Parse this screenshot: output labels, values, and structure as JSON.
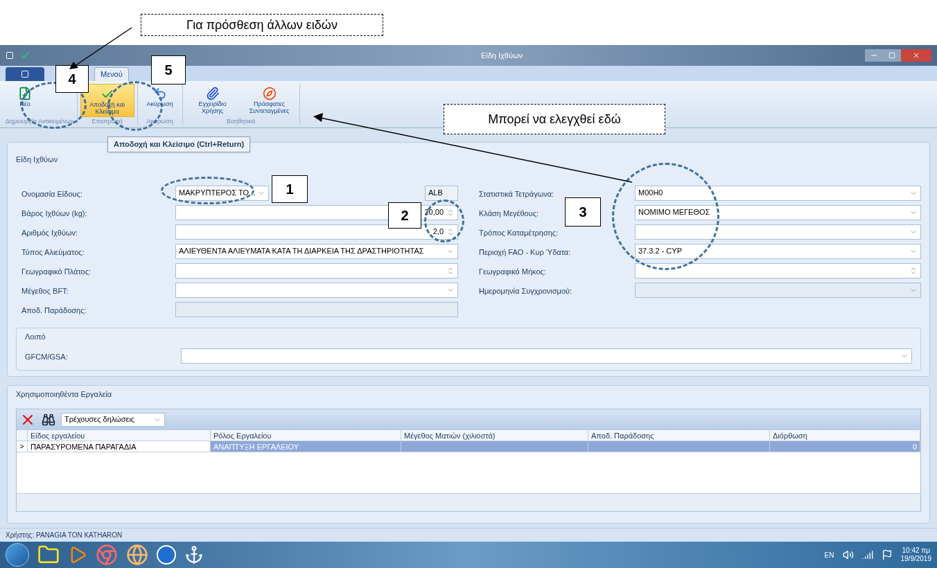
{
  "annotations": {
    "callouts": [
      {
        "text": "Για πρόσθεση άλλων ειδών"
      },
      {
        "text": "Μπορεί να ελεγχθεί εδώ"
      }
    ],
    "markers": [
      {
        "text": "4"
      },
      {
        "text": "5"
      },
      {
        "text": "1"
      },
      {
        "text": "2"
      },
      {
        "text": "3"
      }
    ]
  },
  "window": {
    "title": "Είδη Ιχθύων"
  },
  "tabs": [
    {
      "label": "Μενού",
      "selected": true
    }
  ],
  "ribbon": [
    {
      "group": "Δημιουργία Αντικειμένων",
      "buttons": [
        {
          "label": "Νέο",
          "hovered": false
        }
      ]
    },
    {
      "group": "Επιστροφή",
      "buttons": [
        {
          "label": "Αποδοχή και Κλείσιμο",
          "hovered": true
        }
      ]
    },
    {
      "group": "Ακύρωση",
      "buttons": [
        {
          "label": "Ακύρωση",
          "hovered": false
        }
      ]
    },
    {
      "group": "Βοηθητικά",
      "buttons": [
        {
          "label": "Εγχειρίδιο Χρήσης",
          "hovered": false
        },
        {
          "label": "Πρόσφατες Συντεταγμένες",
          "hovered": false
        }
      ]
    }
  ],
  "tooltip": "Αποδοχή και Κλείσιμο (Ctrl+Return)",
  "species_group": {
    "title": "Είδη Ιχθύων",
    "left_fields": [
      {
        "label": "Ονομασία Είδους:",
        "kind": "combo_short",
        "value": "ΜΑΚΡΥΠΤΕΡΟΣ ΤΟ...",
        "code": "ALB"
      },
      {
        "label": "Βάρος Ιχθύων (kg):",
        "kind": "spin",
        "value": "20,00"
      },
      {
        "label": "Αριθμός Ιχθύων:",
        "kind": "spin",
        "value": "2,0"
      },
      {
        "label": "Τύπος Αλιεύματος:",
        "kind": "combo",
        "value": "ΑΛΙΕΥΘΕΝΤΑ ΑΛΙΕΥΜΑΤΑ ΚΑΤΑ ΤΗ ΔΙΑΡΚΕΙΑ ΤΗΣ ΔΡΑΣΤΗΡΙΟΤΗΤΑΣ"
      },
      {
        "label": "Γεωγραφικό Πλάτος:",
        "kind": "spin"
      },
      {
        "label": "Μέγεθος BFT:",
        "kind": "combo"
      },
      {
        "label": "Αποδ. Παράδοσης:",
        "kind": "readonly"
      }
    ],
    "right_fields": [
      {
        "label": "Στατιστικά Τετράγωνα:",
        "kind": "combo",
        "value": "M00H0"
      },
      {
        "label": "Κλάση Μεγέθους:",
        "kind": "combo",
        "value": "ΝΟΜΙΜΟ ΜΕΓΕΘΟΣ"
      },
      {
        "label": "Τρόπος Καταμέτρησης:",
        "kind": "combo"
      },
      {
        "label": "Περιοχή FAO - Κυρ Ύδατα:",
        "kind": "combo",
        "value": "37.3.2 - CYP"
      },
      {
        "label": "Γεωγραφικό Μήκος:",
        "kind": "spin"
      },
      {
        "label": "Ημερομηνία Συγχρονισμού:",
        "kind": "readonly_combo"
      }
    ]
  },
  "other_group": {
    "title": "Λοιπό",
    "fields": [
      {
        "label": "GFCM/GSA:",
        "kind": "combo"
      }
    ]
  },
  "tools_group": {
    "title": "Χρησιμοποιηθέντα Εργαλεία",
    "filter": "Τρέχουσες δηλώσεις",
    "columns": [
      "Είδος εργαλείου",
      "Ρόλος Εργαλείου",
      "Μέγεθος Ματιών (χιλιοστά)",
      "Αποδ. Παράδοσης",
      "Διόρθωση"
    ],
    "rows": [
      {
        "marker": ">",
        "cells": [
          "ΠΑΡΑΣΥΡΟΜΕΝΑ ΠΑΡΑΓΑΔΙΑ",
          "ΑΝΑΠΤΥΞΗ ΕΡΓΑΛΕΙΟΥ",
          "",
          "",
          "0"
        ],
        "selected": true
      }
    ]
  },
  "status_bar": "Χρήστης: PANAGIA TON KATHARON",
  "taskbar": {
    "language": "EN",
    "time": "10:42 πμ",
    "date": "19/9/2019"
  }
}
